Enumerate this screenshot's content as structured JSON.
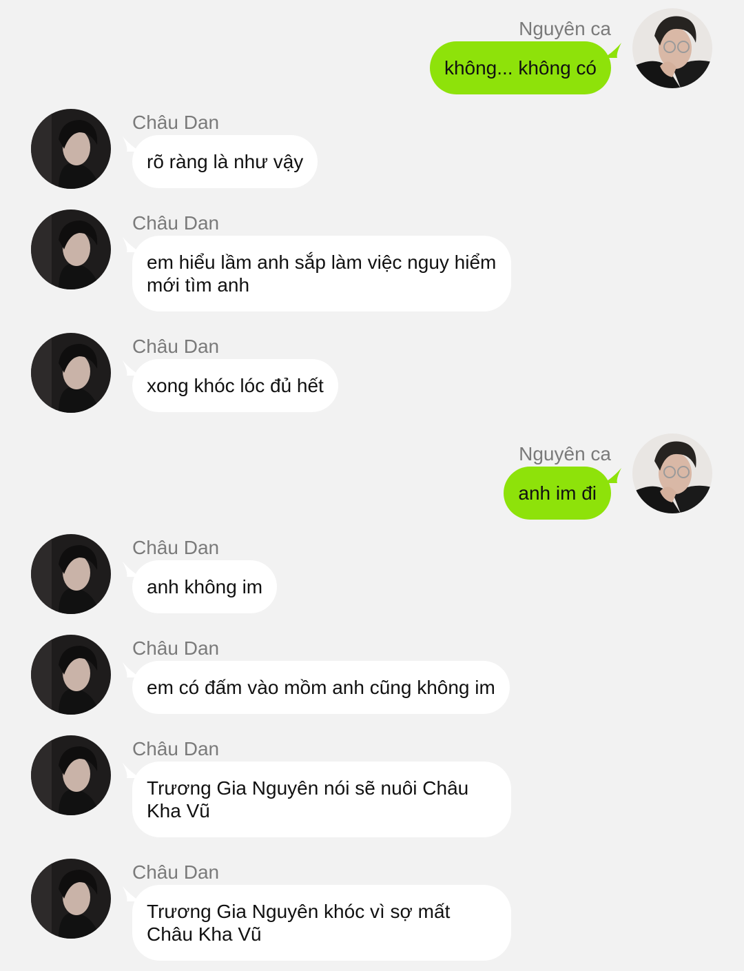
{
  "colors": {
    "background": "#f2f2f2",
    "incoming_bubble": "#ffffff",
    "outgoing_bubble": "#8ee20a",
    "sender_name": "#7a7a7a",
    "text": "#111111"
  },
  "messages": [
    {
      "side": "right",
      "sender": "Nguyên ca",
      "text": "không... không có",
      "avatar": "avatar-nguyen-ca"
    },
    {
      "side": "left",
      "sender": "Châu Dan",
      "text": "rõ ràng là như vậy",
      "avatar": "avatar-chau-dan"
    },
    {
      "side": "left",
      "sender": "Châu Dan",
      "text": "em hiểu lầm anh sắp làm việc nguy hiểm mới tìm anh",
      "avatar": "avatar-chau-dan"
    },
    {
      "side": "left",
      "sender": "Châu Dan",
      "text": "xong khóc lóc đủ hết",
      "avatar": "avatar-chau-dan"
    },
    {
      "side": "right",
      "sender": "Nguyên ca",
      "text": "anh im đi",
      "avatar": "avatar-nguyen-ca"
    },
    {
      "side": "left",
      "sender": "Châu Dan",
      "text": "anh không im",
      "avatar": "avatar-chau-dan"
    },
    {
      "side": "left",
      "sender": "Châu Dan",
      "text": "em có đấm vào mồm anh cũng không im",
      "avatar": "avatar-chau-dan"
    },
    {
      "side": "left",
      "sender": "Châu Dan",
      "text": "Trương Gia Nguyên nói sẽ nuôi Châu Kha Vũ",
      "avatar": "avatar-chau-dan"
    },
    {
      "side": "left",
      "sender": "Châu Dan",
      "text": "Trương Gia Nguyên khóc vì sợ mất Châu Kha Vũ",
      "avatar": "avatar-chau-dan"
    }
  ]
}
